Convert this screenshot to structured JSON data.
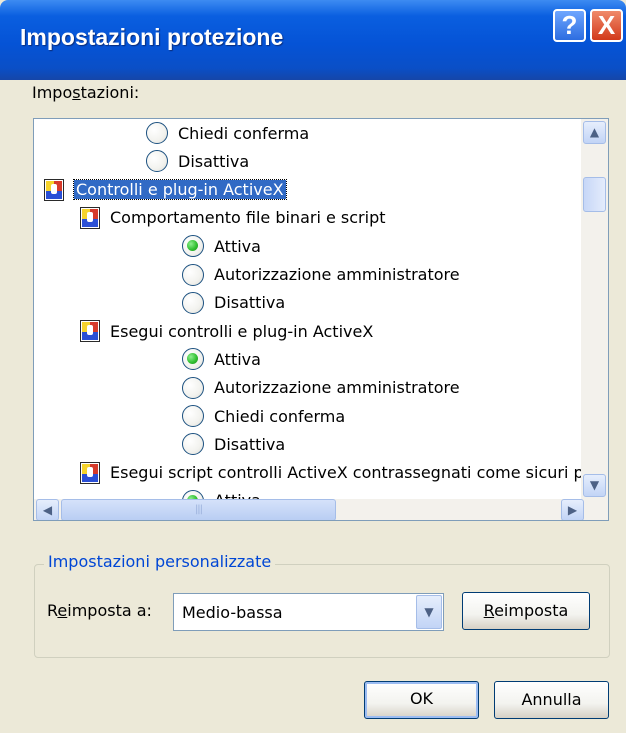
{
  "window": {
    "title": "Impostazioni protezione"
  },
  "title_buttons": {
    "help": "?",
    "close": "X"
  },
  "settings_label": {
    "pre": "Impo",
    "accel": "s",
    "post": "tazioni:"
  },
  "tree": [
    {
      "kind": "radio",
      "label": "Chiedi conferma",
      "checked": false,
      "indent": 1
    },
    {
      "kind": "radio",
      "label": "Disattiva",
      "checked": false,
      "indent": 1
    },
    {
      "kind": "category",
      "label": "Controlli e plug-in ActiveX",
      "selected": true,
      "indent": 0
    },
    {
      "kind": "category",
      "label": "Comportamento file binari e script",
      "selected": false,
      "indent": 1
    },
    {
      "kind": "radio",
      "label": "Attiva",
      "checked": true,
      "indent": 2
    },
    {
      "kind": "radio",
      "label": "Autorizzazione amministratore",
      "checked": false,
      "indent": 2
    },
    {
      "kind": "radio",
      "label": "Disattiva",
      "checked": false,
      "indent": 2
    },
    {
      "kind": "category",
      "label": "Esegui controlli e plug-in ActiveX",
      "selected": false,
      "indent": 1
    },
    {
      "kind": "radio",
      "label": "Attiva",
      "checked": true,
      "indent": 2
    },
    {
      "kind": "radio",
      "label": "Autorizzazione amministratore",
      "checked": false,
      "indent": 2
    },
    {
      "kind": "radio",
      "label": "Chiedi conferma",
      "checked": false,
      "indent": 2
    },
    {
      "kind": "radio",
      "label": "Disattiva",
      "checked": false,
      "indent": 2
    },
    {
      "kind": "category",
      "label": "Esegui script controlli ActiveX contrassegnati come sicuri per lo scripting",
      "selected": false,
      "indent": 1
    },
    {
      "kind": "radio",
      "label": "Attiva",
      "checked": true,
      "indent": 2
    }
  ],
  "custom_group": {
    "legend": "Impostazioni personalizzate",
    "reset_to_label": {
      "pre": "R",
      "accel": "e",
      "post": "imposta a:"
    },
    "combo_value": "Medio-bassa",
    "reset_button": {
      "accel": "R",
      "post": "eimposta"
    }
  },
  "footer": {
    "ok": "OK",
    "cancel": "Annulla"
  }
}
